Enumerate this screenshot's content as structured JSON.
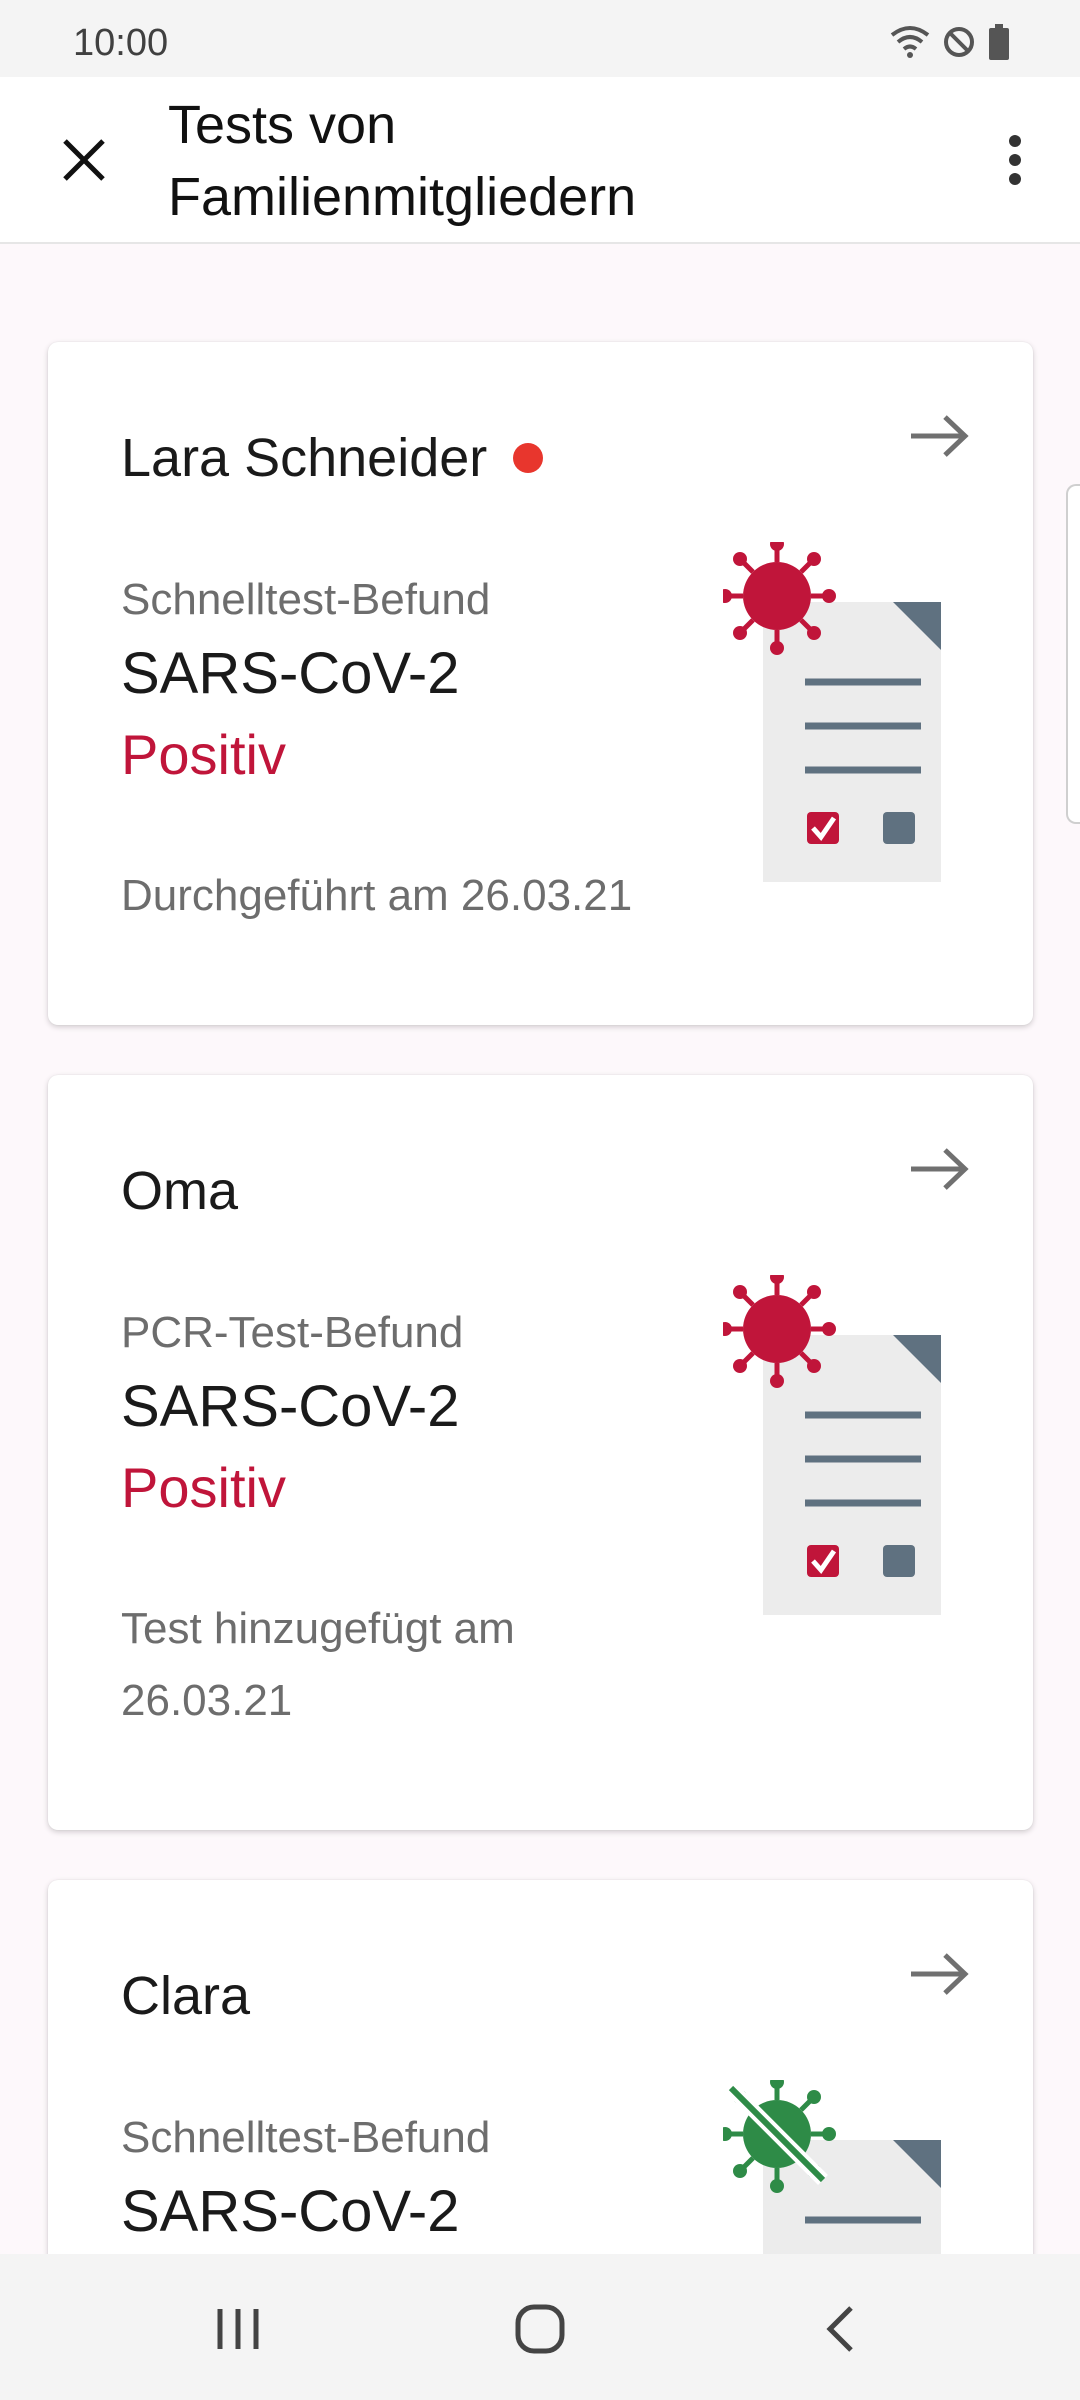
{
  "status_bar": {
    "time": "10:00",
    "icons": [
      "wifi-icon",
      "do-not-disturb-icon",
      "battery-icon"
    ]
  },
  "app_bar": {
    "title_line1": "Tests von",
    "title_line2": "Familienmitgliedern",
    "close_icon": "close-icon",
    "menu_icon": "more-vert-icon"
  },
  "colors": {
    "positive": "#c0153a",
    "negative": "#2e8b47",
    "new_dot": "#e8362d",
    "document": "#ececec",
    "document_lines": "#607080"
  },
  "cards": [
    {
      "name": "Lara Schneider",
      "has_new_badge": true,
      "test_type": "Schnelltest-Befund",
      "pathogen": "SARS-CoV-2",
      "result": "Positiv",
      "date_line1": "Durchgeführt am 26.03.21",
      "date_line2": "",
      "illustration": "positive-test-icon"
    },
    {
      "name": "Oma",
      "has_new_badge": false,
      "test_type": "PCR-Test-Befund",
      "pathogen": "SARS-CoV-2",
      "result": "Positiv",
      "date_line1": "Test hinzugefügt am",
      "date_line2": "26.03.21",
      "illustration": "positive-test-icon"
    },
    {
      "name": "Clara",
      "has_new_badge": false,
      "test_type": "Schnelltest-Befund",
      "pathogen": "SARS-CoV-2",
      "illustration": "negative-test-icon"
    }
  ],
  "nav_bar": {
    "recents_icon": "recent-apps-icon",
    "home_icon": "home-icon",
    "back_icon": "back-icon"
  }
}
